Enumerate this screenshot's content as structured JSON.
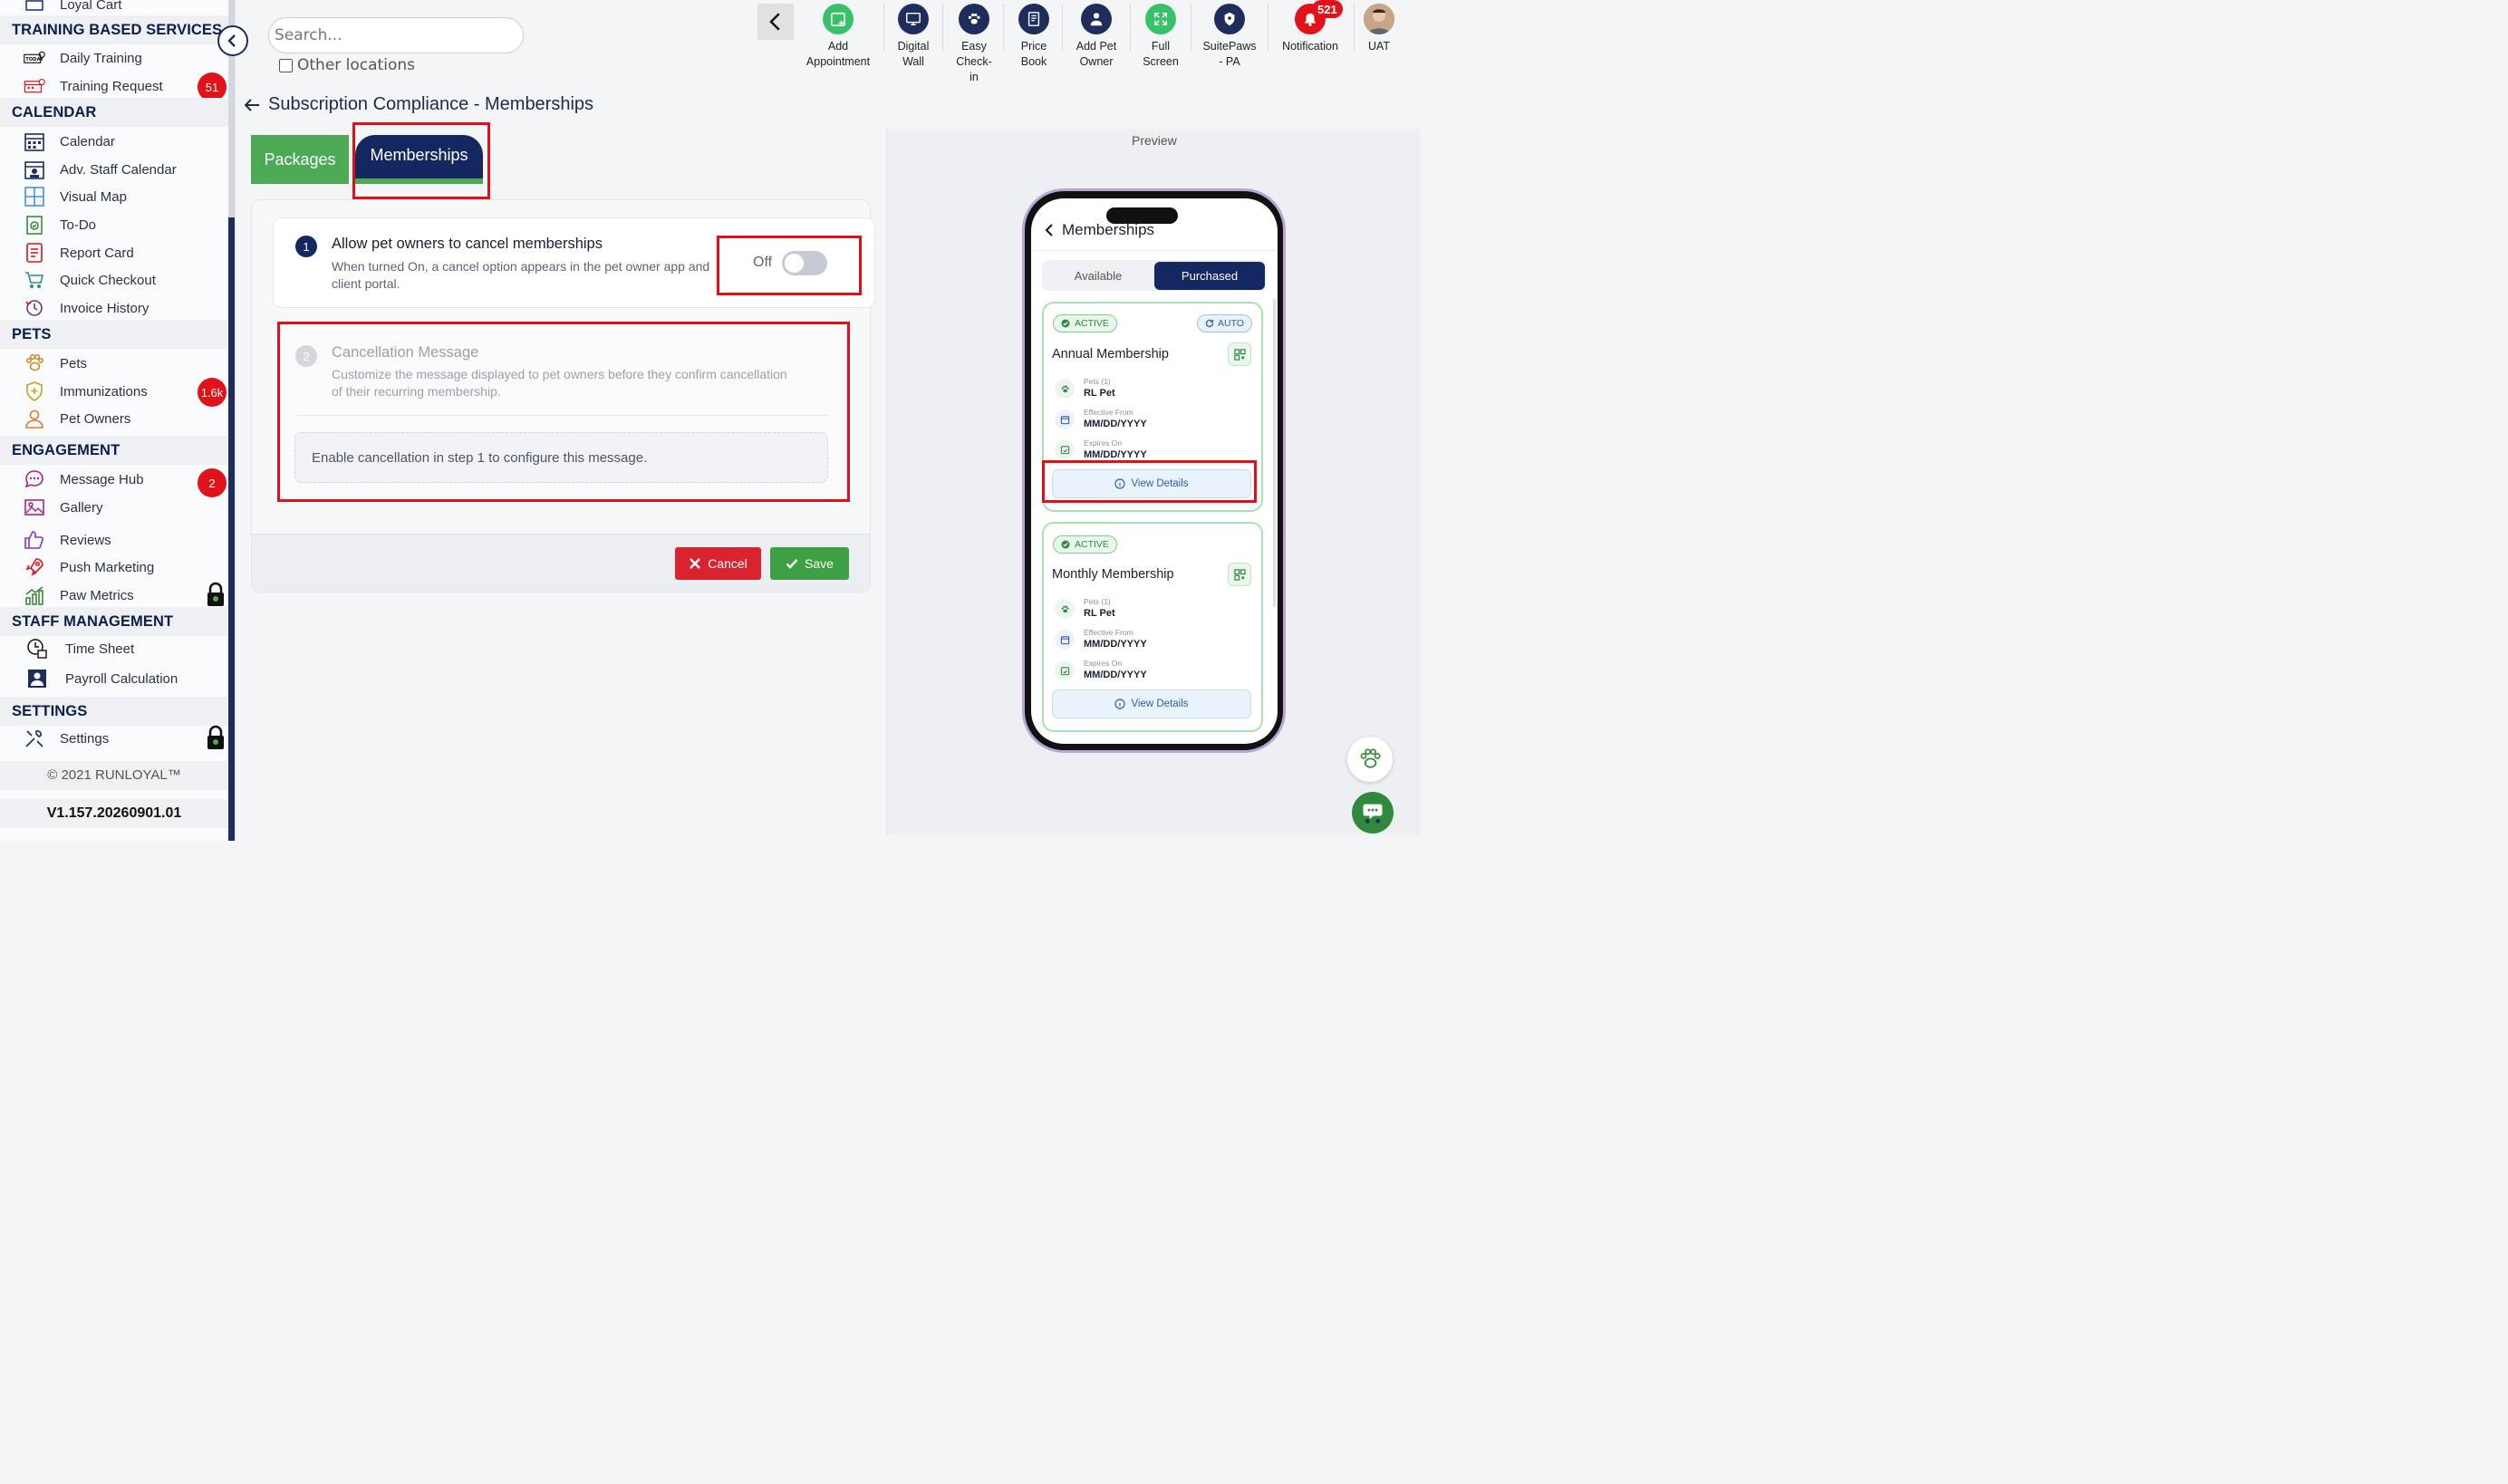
{
  "sidebar": {
    "top_item": "Loyal Cart",
    "sections": {
      "training": "TRAINING BASED SERVICES",
      "calendar": "CALENDAR",
      "pets": "PETS",
      "engagement": "ENGAGEMENT",
      "staff": "STAFF MANAGEMENT",
      "settings": "SETTINGS"
    },
    "items": {
      "daily_training": "Daily Training",
      "training_request": "Training Request",
      "calendar": "Calendar",
      "adv_staff_calendar": "Adv. Staff Calendar",
      "visual_map": "Visual Map",
      "todo": "To-Do",
      "report_card": "Report Card",
      "quick_checkout": "Quick Checkout",
      "invoice_history": "Invoice History",
      "pets": "Pets",
      "immunizations": "Immunizations",
      "pet_owners": "Pet Owners",
      "message_hub": "Message Hub",
      "gallery": "Gallery",
      "reviews": "Reviews",
      "push_marketing": "Push Marketing",
      "paw_metrics": "Paw Metrics",
      "time_sheet": "Time Sheet",
      "payroll_calculation": "Payroll Calculation",
      "settings": "Settings"
    },
    "badges": {
      "training_request": "51",
      "immunizations": "1.6k",
      "message_hub": "2"
    },
    "copyright": "© 2021  RUNLOYAL™",
    "version": "V1.157.20260901.01"
  },
  "topbar": {
    "search_placeholder": "Search...",
    "other_locations": "Other locations",
    "add_appointment_1": "Add",
    "add_appointment_2": "Appointment",
    "digital_wall_1": "Digital",
    "digital_wall_2": "Wall",
    "easy_checkin_1": "Easy",
    "easy_checkin_2": "Check-",
    "easy_checkin_3": "in",
    "price_book_1": "Price",
    "price_book_2": "Book",
    "add_pet_owner_1": "Add Pet",
    "add_pet_owner_2": "Owner",
    "full_screen_1": "Full",
    "full_screen_2": "Screen",
    "suitepaws_1": "SuitePaws",
    "suitepaws_2": "- PA",
    "notification": "Notification",
    "notification_count": "521",
    "user": "UAT"
  },
  "page": {
    "title": "Subscription Compliance - Memberships",
    "tab_packages": "Packages",
    "tab_memberships": "Memberships",
    "step1_num": "1",
    "step1_title": "Allow pet owners to cancel memberships",
    "step1_desc_1": "When turned On, a cancel option appears in the pet owner app and",
    "step1_desc_2": "client portal.",
    "toggle_state": "Off",
    "step2_num": "2",
    "step2_title": "Cancellation Message",
    "step2_desc_1": "Customize the message displayed to pet owners before they confirm cancellation",
    "step2_desc_2": "of their recurring membership.",
    "step2_placeholder": "Enable cancellation in step 1 to configure this message.",
    "cancel_label": "Cancel",
    "save_label": "Save"
  },
  "preview": {
    "label": "Preview",
    "screen_title": "Memberships",
    "seg_available": "Available",
    "seg_purchased": "Purchased",
    "card1": {
      "status": "ACTIVE",
      "renewal": "AUTO",
      "title": "Annual Membership",
      "pets_label": "Pets (1)",
      "pets_value": "RL Pet",
      "effective_label": "Effective From",
      "effective_value": "MM/DD/YYYY",
      "expires_label": "Expires On",
      "expires_value": "MM/DD/YYYY",
      "button": "View Details"
    },
    "card2": {
      "status": "ACTIVE",
      "title": "Monthly Membership",
      "pets_label": "Pets (1)",
      "pets_value": "RL Pet",
      "effective_label": "Effective From",
      "effective_value": "MM/DD/YYYY",
      "expires_label": "Expires On",
      "expires_value": "MM/DD/YYYY",
      "button": "View Details"
    }
  },
  "colors": {
    "navy": "#142760",
    "green": "#4caa55",
    "red_highlight": "#e0101a",
    "badge_red": "#e1121a",
    "toolbar_icon_green": "#37c26a",
    "toolbar_icon_navy": "#1f2d5c"
  }
}
